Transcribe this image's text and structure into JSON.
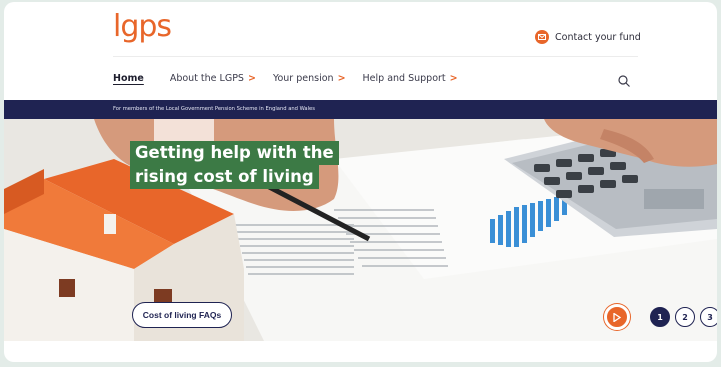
{
  "header": {
    "logo_text": "lgps",
    "contact_label": "Contact your fund"
  },
  "nav": {
    "items": [
      {
        "label": "Home",
        "has_chevron": false
      },
      {
        "label": "About the LGPS",
        "has_chevron": true
      },
      {
        "label": "Your pension",
        "has_chevron": true
      },
      {
        "label": "Help and Support",
        "has_chevron": true
      }
    ],
    "chevron": ">"
  },
  "banner": {
    "text": "For members of the Local Government Pension Scheme in England and Wales"
  },
  "hero": {
    "headline_line1": "Getting help with the",
    "headline_line2": "rising cost of living",
    "cta_label": "Cost of living FAQs",
    "slides": [
      "1",
      "2",
      "3"
    ],
    "active_slide": "1"
  },
  "colors": {
    "brand_orange": "#e8662a",
    "navy": "#1f2352",
    "headline_green": "#3c7a45"
  },
  "icons": [
    "mail-icon",
    "search-icon",
    "play-icon"
  ]
}
